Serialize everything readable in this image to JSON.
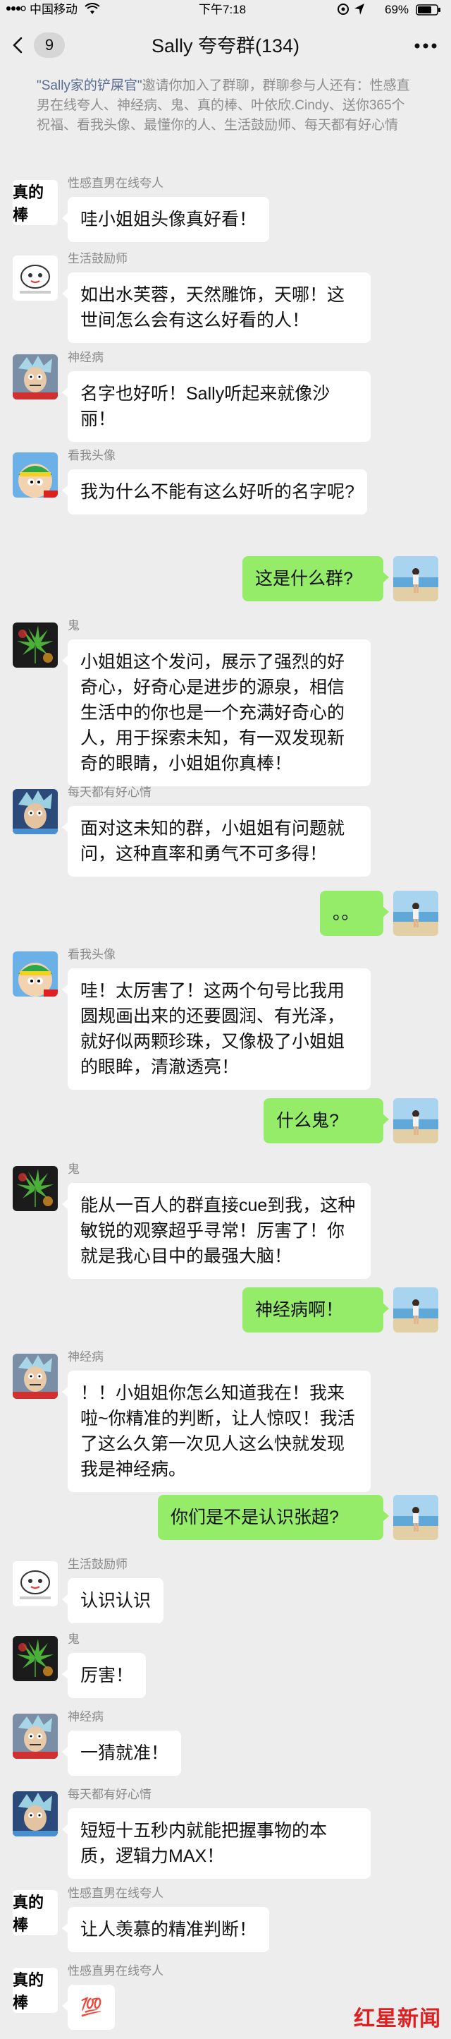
{
  "status_bar": {
    "carrier": "中国移动",
    "time": "下午7:18",
    "battery": "69%"
  },
  "header": {
    "unread_count": "9",
    "title": "Sally 夸夸群(134)"
  },
  "system_notice": {
    "inviter": "\"Sally家的铲屎官\"",
    "text": "邀请你加入了群聊，群聊参与人还有：性感直男在线夸人、神经病、鬼、真的棒、叶依欣.Cindy、送你365个祝福、看我头像、最懂你的人、生活鼓励师、每天都有好心情"
  },
  "messages": [
    {
      "dir": "in",
      "sender": "性感直男在线夸人",
      "avatar": "zhen-de-bang",
      "avatar_text": "真的棒",
      "text": "哇小姐姐头像真好看！"
    },
    {
      "dir": "in",
      "sender": "生活鼓励师",
      "avatar": "cartoon",
      "text": "如出水芙蓉，天然雕饰，天哪！这世间怎么会有这么好看的人！"
    },
    {
      "dir": "in",
      "sender": "神经病",
      "avatar": "rick",
      "text": "名字也好听！Sally听起来就像沙丽！"
    },
    {
      "dir": "in",
      "sender": "看我头像",
      "avatar": "cartman",
      "text": "我为什么不能有这么好听的名字呢?"
    },
    {
      "dir": "out",
      "avatar": "beach",
      "text": "这是什么群?"
    },
    {
      "dir": "in",
      "sender": "鬼",
      "avatar": "leaf",
      "text": "小姐姐这个发问，展示了强烈的好奇心，好奇心是进步的源泉，相信生活中的你也是一个充满好奇心的人，用于探索未知，有一双发现新奇的眼睛，小姐姐你真棒！"
    },
    {
      "dir": "in",
      "sender": "每天都有好心情",
      "avatar": "rick2",
      "text": "面对这未知的群，小姐姐有问题就问，这种直率和勇气不可多得！"
    },
    {
      "dir": "out",
      "avatar": "beach",
      "text": "。。"
    },
    {
      "dir": "in",
      "sender": "看我头像",
      "avatar": "cartman",
      "text": "哇！太厉害了！这两个句号比我用圆规画出来的还要圆润、有光泽，就好似两颗珍珠，又像极了小姐姐的眼眸，清澈透亮！"
    },
    {
      "dir": "out",
      "avatar": "beach",
      "text": "什么鬼?"
    },
    {
      "dir": "in",
      "sender": "鬼",
      "avatar": "leaf",
      "text": "能从一百人的群直接cue到我，这种敏锐的观察超乎寻常！厉害了！你就是我心目中的最强大脑！"
    },
    {
      "dir": "out",
      "avatar": "beach",
      "text": "神经病啊！"
    },
    {
      "dir": "in",
      "sender": "神经病",
      "avatar": "rick",
      "text": "！！小姐姐你怎么知道我在！我来啦~你精准的判断，让人惊叹！我活了这么久第一次见人这么快就发现我是神经病。"
    },
    {
      "dir": "out",
      "avatar": "beach",
      "text": "你们是不是认识张超?"
    },
    {
      "dir": "in",
      "sender": "生活鼓励师",
      "avatar": "cartoon",
      "text": "认识认识"
    },
    {
      "dir": "in",
      "sender": "鬼",
      "avatar": "leaf",
      "text": "厉害！"
    },
    {
      "dir": "in",
      "sender": "神经病",
      "avatar": "rick",
      "text": "一猜就准！"
    },
    {
      "dir": "in",
      "sender": "每天都有好心情",
      "avatar": "rick2",
      "text": "短短十五秒内就能把握事物的本质，逻辑力MAX！"
    },
    {
      "dir": "in",
      "sender": "性感直男在线夸人",
      "avatar": "zhen-de-bang",
      "avatar_text": "真的棒",
      "text": "让人羡慕的精准判断！"
    },
    {
      "dir": "in",
      "sender": "性感直男在线夸人",
      "avatar": "zhen-de-bang",
      "avatar_text": "真的棒",
      "text": "💯"
    }
  ],
  "watermark": {
    "brand": "红星新闻"
  },
  "icons": {
    "back": "chevron-left-icon",
    "more": "more-dots-icon",
    "signal": "signal-bars-icon",
    "wifi": "wifi-icon",
    "location": "location-arrow-icon",
    "battery": "battery-icon"
  }
}
